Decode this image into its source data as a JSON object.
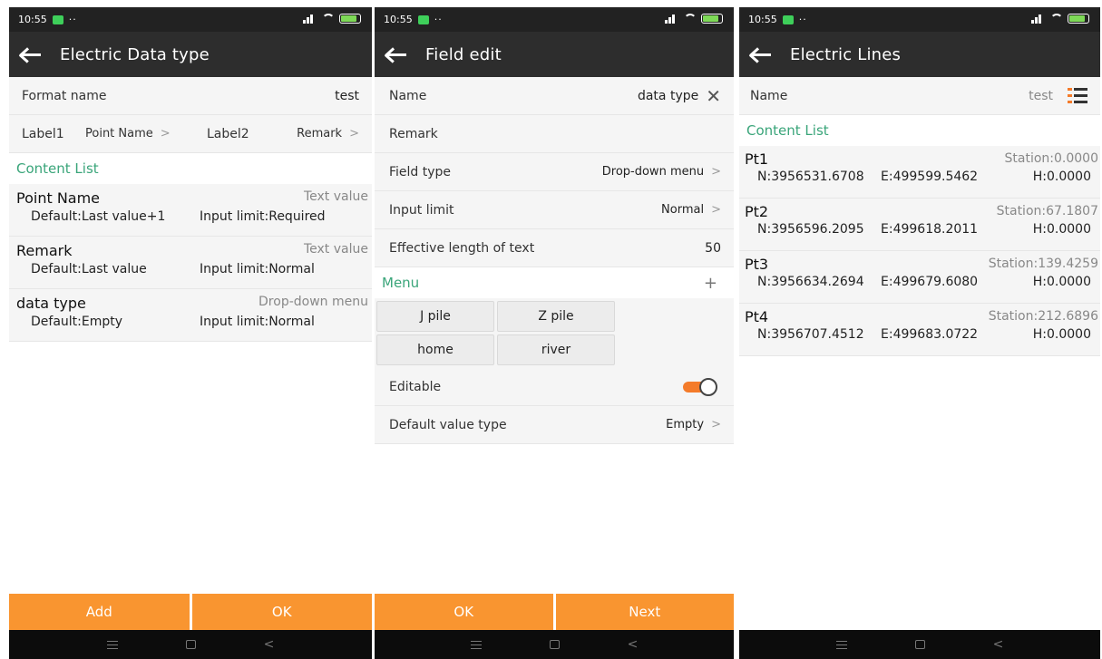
{
  "status": {
    "time": "10:55",
    "dots": "··"
  },
  "screen1": {
    "title": "Electric Data type",
    "format_label": "Format name",
    "format_value": "test",
    "label1": "Label1",
    "label1_value": "Point Name",
    "label2": "Label2",
    "label2_value": "Remark",
    "section": "Content List",
    "items": [
      {
        "name": "Point Name",
        "type": "Text value",
        "default": "Default:Last value+1",
        "limit": "Input limit:Required"
      },
      {
        "name": "Remark",
        "type": "Text value",
        "default": "Default:Last value",
        "limit": "Input limit:Normal"
      },
      {
        "name": "data type",
        "type": "Drop-down menu",
        "default": "Default:Empty",
        "limit": "Input limit:Normal"
      }
    ],
    "btn_add": "Add",
    "btn_ok": "OK"
  },
  "screen2": {
    "title": "Field edit",
    "name_label": "Name",
    "name_value": "data type",
    "remark_label": "Remark",
    "field_type_label": "Field type",
    "field_type_value": "Drop-down menu",
    "input_limit_label": "Input limit",
    "input_limit_value": "Normal",
    "eff_len_label": "Effective length of text",
    "eff_len_value": "50",
    "menu_label": "Menu",
    "menu_add": "+",
    "menu_items": [
      "J pile",
      "Z pile",
      "home",
      "river"
    ],
    "editable_label": "Editable",
    "editable_on": true,
    "default_type_label": "Default value type",
    "default_type_value": "Empty",
    "btn_ok": "OK",
    "btn_next": "Next"
  },
  "screen3": {
    "title": "Electric Lines",
    "name_label": "Name",
    "name_value": "test",
    "section": "Content List",
    "points": [
      {
        "name": "Pt1",
        "station": "Station:0.0000",
        "n": "N:3956531.6708",
        "e": "E:499599.5462",
        "h": "H:0.0000"
      },
      {
        "name": "Pt2",
        "station": "Station:67.1807",
        "n": "N:3956596.2095",
        "e": "E:499618.2011",
        "h": "H:0.0000"
      },
      {
        "name": "Pt3",
        "station": "Station:139.4259",
        "n": "N:3956634.2694",
        "e": "E:499679.6080",
        "h": "H:0.0000"
      },
      {
        "name": "Pt4",
        "station": "Station:212.6896",
        "n": "N:3956707.4512",
        "e": "E:499683.0722",
        "h": "H:0.0000"
      }
    ]
  },
  "colors": {
    "accent": "#f99530",
    "section_green": "#3aa57a",
    "toggle_on": "#f47b2a"
  },
  "icons": {
    "back": "back-arrow-icon",
    "close": "close-icon",
    "list": "list-icon",
    "chevron": "chevron-right-icon"
  }
}
